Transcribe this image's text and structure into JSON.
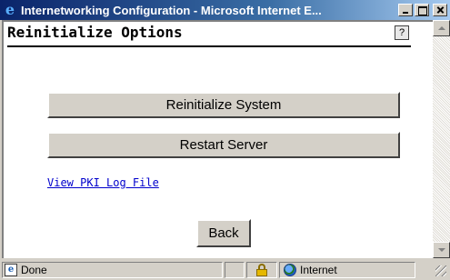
{
  "window": {
    "title": "Internetworking Configuration - Microsoft Internet E...",
    "icon": "ie-logo-icon"
  },
  "page": {
    "title": "Reinitialize Options",
    "help_label": "?"
  },
  "buttons": {
    "reinitialize": "Reinitialize System",
    "restart": "Restart Server",
    "back": "Back"
  },
  "links": {
    "view_pki_log": "View PKI Log File"
  },
  "status": {
    "text": "Done",
    "zone": "Internet"
  }
}
